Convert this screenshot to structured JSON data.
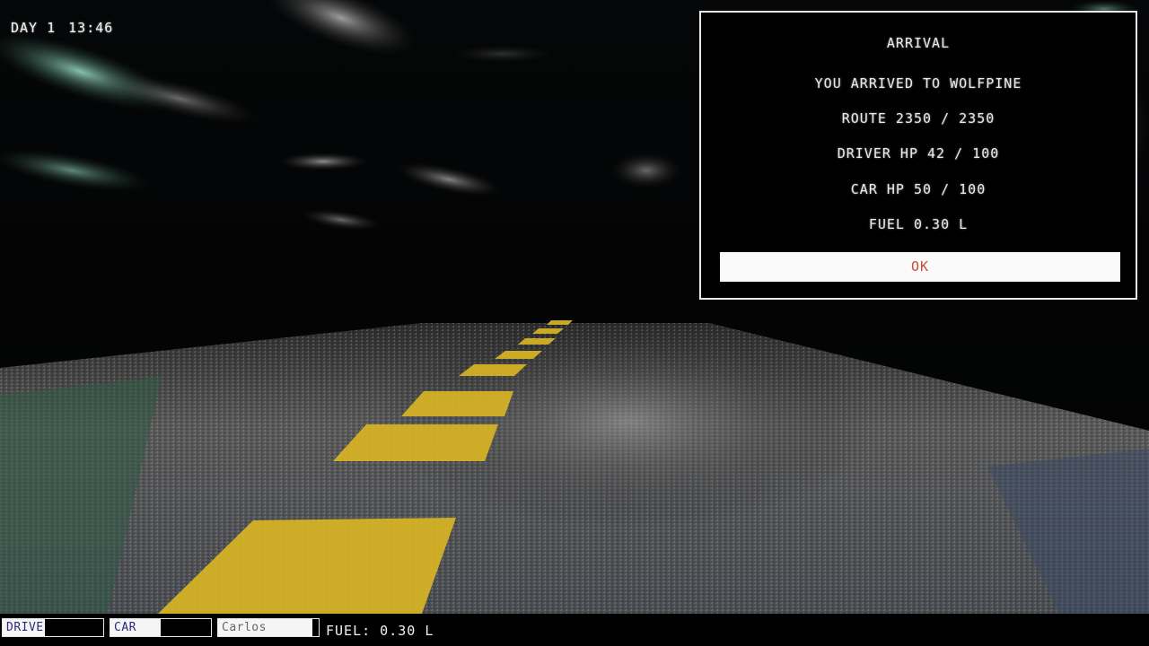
{
  "hud_top": {
    "day": "DAY 1",
    "time": "13:46"
  },
  "arrival_dialog": {
    "title": "ARRIVAL",
    "message": "YOU ARRIVED TO WOLFPINE",
    "route": "ROUTE 2350 / 2350",
    "driver_hp": "DRIVER HP 42 / 100",
    "car_hp": "CAR HP 50 / 100",
    "fuel": "FUEL 0.30 L",
    "ok_label": "OK"
  },
  "hud_bottom": {
    "drive_label": "DRIVE",
    "drive_fill_fraction": 0.42,
    "car_label": "CAR",
    "car_fill_fraction": 0.5,
    "name_value": "Carlos",
    "fuel_label": "FUEL: 0.30 L"
  },
  "colors": {
    "ok_text": "#c84a3a",
    "road_line": "#d8b424",
    "hud_border": "#e6e6e6"
  }
}
